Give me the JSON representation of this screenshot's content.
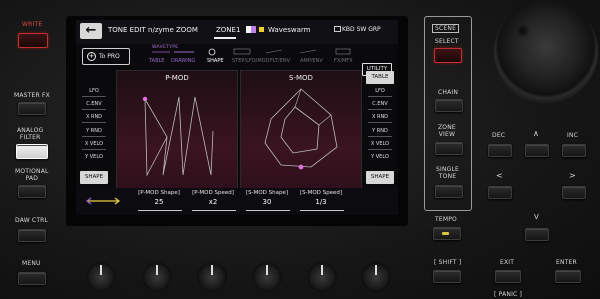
{
  "hardware": {
    "write": "WRITE",
    "master_fx": "MASTER FX",
    "analog_filter": "ANALOG\nFILTER",
    "motional_pad": "MOTIONAL\nPAD",
    "daw_ctrl": "DAW CTRL",
    "menu": "MENU",
    "scene": "SCENE",
    "select": "SELECT",
    "chain": "CHAIN",
    "zone_view": "ZONE\nVIEW",
    "single_tone": "SINGLE\nTONE",
    "tempo": "TEMPO",
    "shift": "[ SHIFT ]",
    "dec": "DEC",
    "inc": "INC",
    "up": "∧",
    "left": "<",
    "right": ">",
    "down": "V",
    "exit": "EXIT",
    "panic": "[ PANIC ]",
    "enter": "ENTER"
  },
  "screen": {
    "back_icon": "←",
    "title": "TONE EDIT n/zyme ZOOM",
    "zone": "ZONE1",
    "tone_name": "Waveswarm",
    "kbd_grp": "KBD SW GRP",
    "to_pro": "To PRO",
    "wavetype_label": "WAVETYPE",
    "tabs": [
      {
        "label": "TABLE"
      },
      {
        "label": "DRAWING"
      },
      {
        "label": "SHAPE"
      },
      {
        "label": "STEP/LFO/MOD"
      },
      {
        "label": "FLT/ENV"
      },
      {
        "label": "AMP/ENV"
      },
      {
        "label": "FX/MFX"
      }
    ],
    "utility": "UTILITY",
    "left_side": [
      "LFO",
      "C.ENV",
      "X RND",
      "Y RND",
      "X VELO",
      "Y VELO"
    ],
    "right_side": [
      "LFO",
      "C.ENV",
      "X RND",
      "Y RND",
      "X VELO",
      "Y VELO"
    ],
    "left_btn": "SHAPE",
    "right_top_btn": "TABLE",
    "right_btn": "SHAPE",
    "pmod_title": "P-MOD",
    "smod_title": "S-MOD",
    "params": [
      {
        "name": "[P-MOD Shape]",
        "value": "25"
      },
      {
        "name": "[P-MOD Speed]",
        "value": "x2"
      },
      {
        "name": "[S-MOD Shape]",
        "value": "30"
      },
      {
        "name": "[S-MOD Speed]",
        "value": "1/3"
      }
    ]
  },
  "colors": {
    "accent_purple": "#9a66cc",
    "write_red": "#c23030",
    "knob_blue": "#2b86f0",
    "pink_point": "#e070e0"
  }
}
